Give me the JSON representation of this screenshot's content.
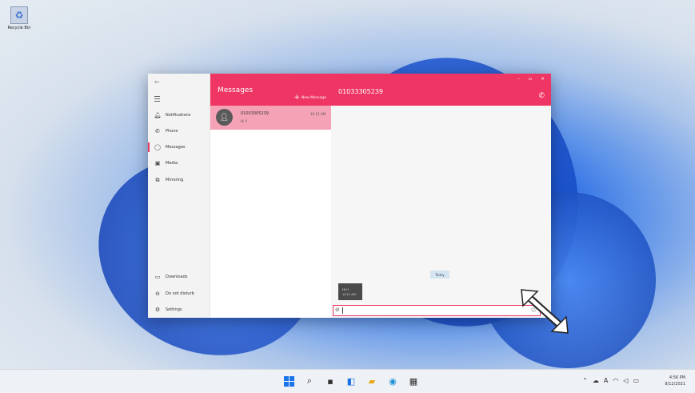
{
  "desktop": {
    "recycle_label": "Recycle Bin"
  },
  "nav": {
    "back": "←",
    "items": [
      {
        "label": "Notifications",
        "icon": "bell-icon"
      },
      {
        "label": "Phone",
        "icon": "phone-icon"
      },
      {
        "label": "Messages",
        "icon": "messages-icon"
      },
      {
        "label": "Media",
        "icon": "media-icon"
      },
      {
        "label": "Mirroring",
        "icon": "mirroring-icon"
      }
    ],
    "bottom_items": [
      {
        "label": "Downloads",
        "icon": "downloads-icon"
      },
      {
        "label": "Do not disturb",
        "icon": "do-not-disturb-icon"
      },
      {
        "label": "Settings",
        "icon": "gear-icon"
      }
    ]
  },
  "list": {
    "title": "Messages",
    "new_message": "New Message",
    "conversation": {
      "number": "01033305239",
      "preview": "Hi !!",
      "time": "10:12 AM"
    }
  },
  "chat": {
    "contact": "01033305239",
    "day_label": "Today",
    "message_text": "Hi !!",
    "message_time": "10:12 AM",
    "window_controls": [
      "–",
      "▫",
      "×"
    ]
  },
  "taskbar": {
    "time": "4:56 PM",
    "date": "8/12/2021"
  },
  "colors": {
    "accent": "#ee3563",
    "selected_row": "#f5a2b6"
  }
}
